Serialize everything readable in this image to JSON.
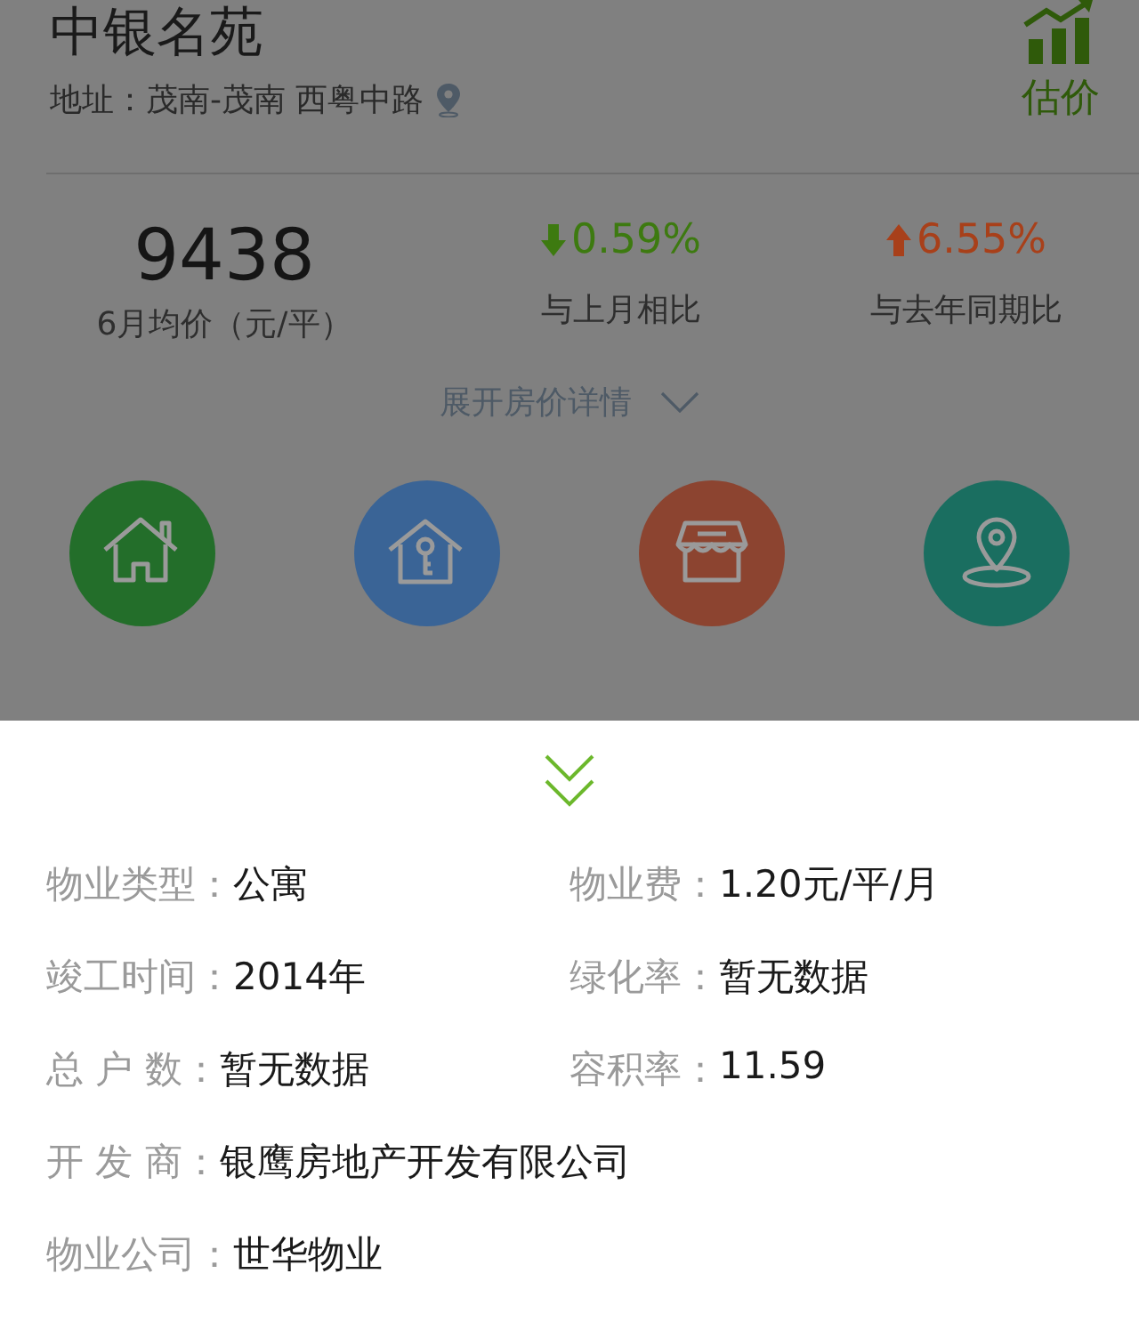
{
  "header": {
    "title": "中银名苑",
    "address": "地址：茂南-茂南 西粤中路",
    "estimate": "估价"
  },
  "price": {
    "value": "9438",
    "label": "6月均价（元/平）"
  },
  "changes": [
    {
      "rising": false,
      "value": "0.59%",
      "label": "与上月相比"
    },
    {
      "rising": true,
      "value": "6.55%",
      "label": "与去年同期比"
    }
  ],
  "expand": "展开房价详情",
  "shortcuts": [
    {
      "kind": "house",
      "color": "#236e2a"
    },
    {
      "kind": "key-house",
      "color": "#3a6496"
    },
    {
      "kind": "shop",
      "color": "#8c4430"
    },
    {
      "kind": "pin",
      "color": "#1a6e60"
    }
  ],
  "details": [
    [
      {
        "label": "物业类型：",
        "value": "公寓"
      },
      {
        "label": "物业费：",
        "value": "1.20元/平/月"
      }
    ],
    [
      {
        "label": "竣工时间：",
        "value": "2014年"
      },
      {
        "label": "绿化率：",
        "value": "暂无数据"
      }
    ],
    [
      {
        "label": "总 户 数：",
        "value": "暂无数据"
      },
      {
        "label": "容积率：",
        "value": "11.59"
      }
    ],
    [
      {
        "label": "开 发 商：",
        "value": "银鹰房地产开发有限公司"
      }
    ],
    [
      {
        "label": "物业公司：",
        "value": "世华物业"
      }
    ]
  ]
}
